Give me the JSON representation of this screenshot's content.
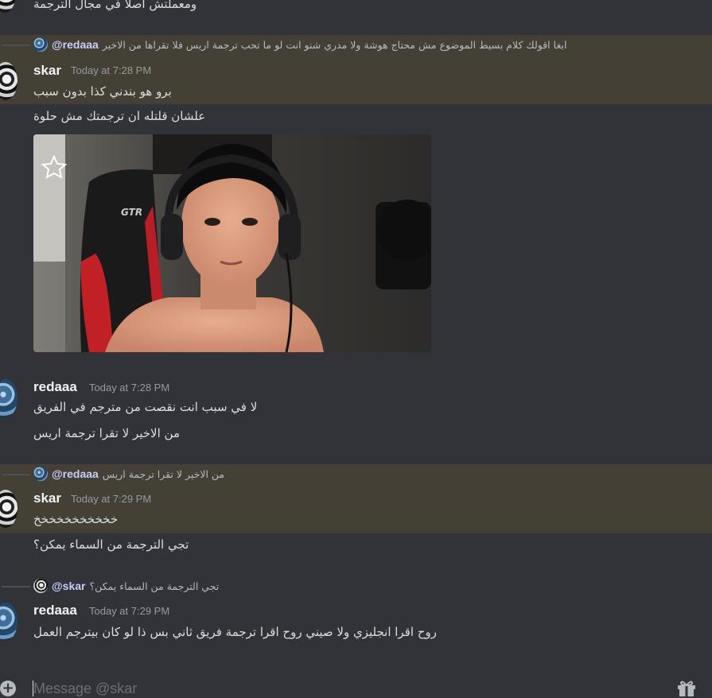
{
  "messages": [
    {
      "type": "continuation",
      "text": "ومعملتش أصلا في مجال الترجمة"
    },
    {
      "type": "reply",
      "reply": {
        "mention": "@redaaa",
        "text": "ابغا اقولك كلام بسيط الموضوع مش محتاج هوشة ولا مدري شنو انت لو ما تحب ترجمة اريس فلا تقراها من الاخير"
      },
      "author": "skar",
      "timestamp": "Today at 7:28 PM",
      "lines": [
        "برو هو بندني كذا بدون سبب",
        "علشان قلتله ان ترجمتك مش حلوة"
      ]
    },
    {
      "type": "message",
      "author": "redaaa",
      "timestamp": "Today at 7:28 PM",
      "lines": [
        "لا في سبب انت نقصت من مترجم في الفريق",
        "من الاخير لا تقرا ترجمة اريس"
      ]
    },
    {
      "type": "reply",
      "reply": {
        "mention": "@redaaa",
        "text": "من الاخير لا تقرا ترجمة اريس"
      },
      "author": "skar",
      "timestamp": "Today at 7:29 PM",
      "lines": [
        "خخخخخخخخخخخ",
        "تجي الترجمة من السماء يمكن؟"
      ]
    },
    {
      "type": "reply",
      "reply": {
        "mention": "@skar",
        "text": "تجي الترجمة من السماء يمكن؟"
      },
      "author": "redaaa",
      "timestamp": "Today at 7:29 PM",
      "lines": [
        "روح اقرا انجليزي ولا صيني روح اقرا ترجمة فريق ثاني بس ذا لو كان بيترجم العمل"
      ]
    }
  ],
  "image_attachment": {
    "overlay_text": "GTR"
  },
  "composer": {
    "placeholder": "Message @skar",
    "add_icon": "plus-circle-icon",
    "gift_icon": "gift-icon"
  },
  "colors": {
    "background": "#313338",
    "highlight": "#444036",
    "mention": "#c9cdfb",
    "username": "#f2f3f5",
    "timestamp": "#949ba4"
  }
}
